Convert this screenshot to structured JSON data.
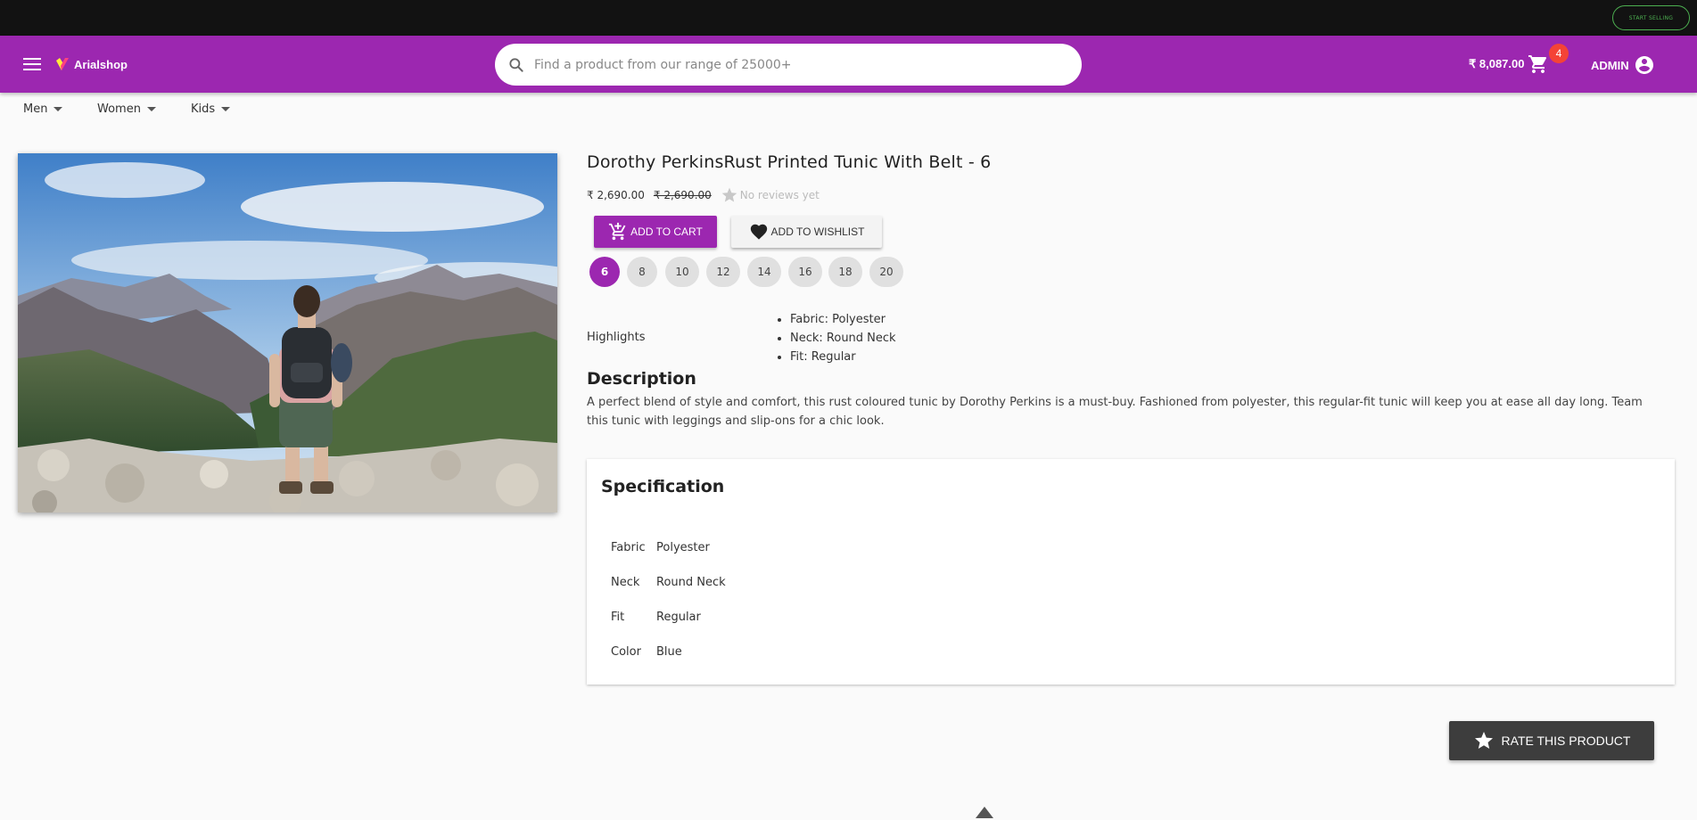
{
  "topbar": {
    "start_selling_label": "START SELLING"
  },
  "header": {
    "brand": "Arialshop",
    "search_placeholder": "Find a product from our range of 25000+",
    "cart_total": "₹ 8,087.00",
    "cart_count": "4",
    "account_label": "ADMIN"
  },
  "nav": {
    "items": [
      {
        "label": "Men"
      },
      {
        "label": "Women"
      },
      {
        "label": "Kids"
      }
    ]
  },
  "product": {
    "title": "Dorothy PerkinsRust Printed Tunic With Belt - 6",
    "price": "₹ 2,690.00",
    "original_price": "₹ 2,690.00",
    "reviews_text": "No reviews yet",
    "add_to_cart_label": "ADD TO CART",
    "add_to_wishlist_label": "ADD TO WISHLIST",
    "sizes": [
      "6",
      "8",
      "10",
      "12",
      "14",
      "16",
      "18",
      "20"
    ],
    "selected_size": "6",
    "highlights_label": "Highlights",
    "highlights": [
      "Fabric: Polyester",
      "Neck: Round Neck",
      "Fit: Regular"
    ],
    "description_title": "Description",
    "description": "A perfect blend of style and comfort, this rust coloured tunic by Dorothy Perkins is a must-buy. Fashioned from polyester, this regular-fit tunic will keep you at ease all day long. Team this tunic with leggings and slip-ons for a chic look."
  },
  "specification": {
    "title": "Specification",
    "rows": [
      {
        "key": "Fabric",
        "value": "Polyester"
      },
      {
        "key": "Neck",
        "value": "Round Neck"
      },
      {
        "key": "Fit",
        "value": "Regular"
      },
      {
        "key": "Color",
        "value": "Blue"
      }
    ]
  },
  "rate_button_label": "RATE THIS PRODUCT",
  "colors": {
    "brand": "#9c27b0",
    "topbar": "#121212",
    "badge": "#f44336",
    "start_selling": "#4caf50",
    "rate_button": "#3d3d3d"
  }
}
